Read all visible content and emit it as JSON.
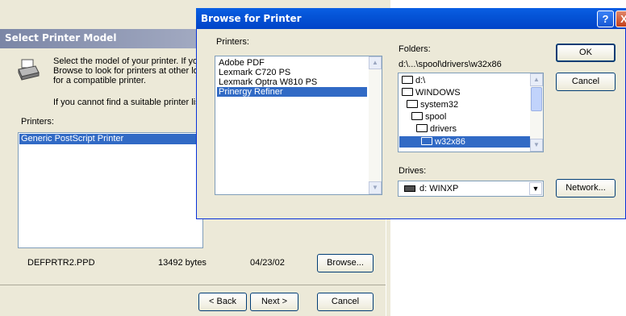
{
  "back_dialog": {
    "title": "Select Printer Model",
    "description": "Select the model of your printer. If you\nBrowse to look for printers at other loc\nfor a compatible printer.",
    "note": "If you cannot find a suitable printer list",
    "printers_label": "Printers:",
    "printers": [
      "Generic PostScript Printer"
    ],
    "file": {
      "name": "DEFPRTR2.PPD",
      "size": "13492 bytes",
      "date": "04/23/02"
    },
    "buttons": {
      "browse": "Browse...",
      "back": "< Back",
      "next": "Next >",
      "cancel": "Cancel"
    }
  },
  "front_dialog": {
    "title": "Browse for Printer",
    "help_glyph": "?",
    "close_glyph": "X",
    "printers_label": "Printers:",
    "printers": [
      {
        "label": "Adobe PDF",
        "selected": false
      },
      {
        "label": "Lexmark C720 PS",
        "selected": false
      },
      {
        "label": "Lexmark Optra W810 PS",
        "selected": false
      },
      {
        "label": "Prinergy Refiner",
        "selected": true
      }
    ],
    "folders_label": "Folders:",
    "folder_path": "d:\\...\\spool\\drivers\\w32x86",
    "folders": [
      {
        "label": "d:\\",
        "level": 0,
        "selected": false
      },
      {
        "label": "WINDOWS",
        "level": 0,
        "selected": false
      },
      {
        "label": "system32",
        "level": 1,
        "selected": false
      },
      {
        "label": "spool",
        "level": 2,
        "selected": false
      },
      {
        "label": "drivers",
        "level": 3,
        "selected": false
      },
      {
        "label": "w32x86",
        "level": 4,
        "selected": true
      }
    ],
    "drives_label": "Drives:",
    "drive": "d: WINXP",
    "buttons": {
      "ok": "OK",
      "cancel": "Cancel",
      "network": "Network..."
    }
  },
  "colors": {
    "selection": "#316ac5",
    "title_active": "#0453d6",
    "title_inactive": "#7b86a6",
    "face": "#ece9d8"
  }
}
